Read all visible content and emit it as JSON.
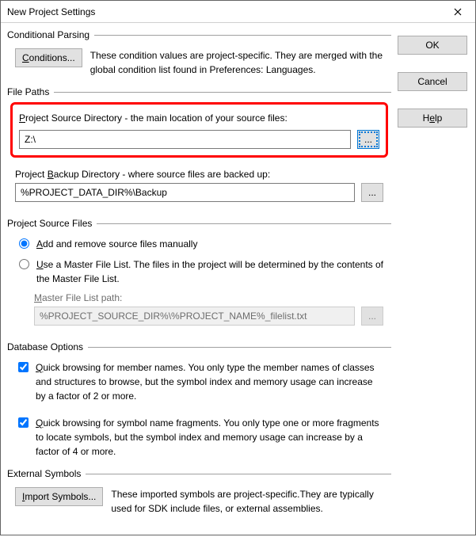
{
  "window": {
    "title": "New Project Settings"
  },
  "buttons": {
    "ok": "OK",
    "cancel": "Cancel",
    "help_pre": "H",
    "help_u": "e",
    "help_post": "lp",
    "conditions_u": "C",
    "conditions_post": "onditions...",
    "browse": "...",
    "import_u": "I",
    "import_post": "mport Symbols..."
  },
  "conditional": {
    "title": "Conditional Parsing",
    "desc": "These condition values are project-specific.  They are merged with the global condition list found in Preferences: Languages."
  },
  "filepaths": {
    "title": "File Paths",
    "src_u": "P",
    "src_post": "roject Source Directory - the main location of your source files:",
    "src_value": "Z:\\",
    "bak_pre": "Project ",
    "bak_u": "B",
    "bak_post": "ackup Directory - where source files are backed up:",
    "bak_value": "%PROJECT_DATA_DIR%\\Backup"
  },
  "sourcefiles": {
    "title": "Project Source Files",
    "opt1_u": "A",
    "opt1_post": "dd and remove source files manually",
    "opt2_u": "U",
    "opt2_post": "se a Master File List. The files in the project will be determined by the contents of the Master File List.",
    "mfl_u": "M",
    "mfl_post": "aster File List path:",
    "mfl_value": "%PROJECT_SOURCE_DIR%\\%PROJECT_NAME%_filelist.txt"
  },
  "dbopt": {
    "title": "Database Options",
    "q1_u": "Q",
    "q1_post": "uick browsing for member names.  You only type the member names of classes and structures to browse, but the symbol index and memory usage can increase by a factor of 2 or more.",
    "q2_u": "Q",
    "q2_post": "uick browsing for symbol name fragments.  You only type one or more fragments to locate symbols, but the symbol index and memory usage can increase by a factor of 4 or more."
  },
  "ext": {
    "title": "External Symbols",
    "desc": "These imported symbols are project-specific.They are typically used for SDK include files, or external assemblies."
  }
}
